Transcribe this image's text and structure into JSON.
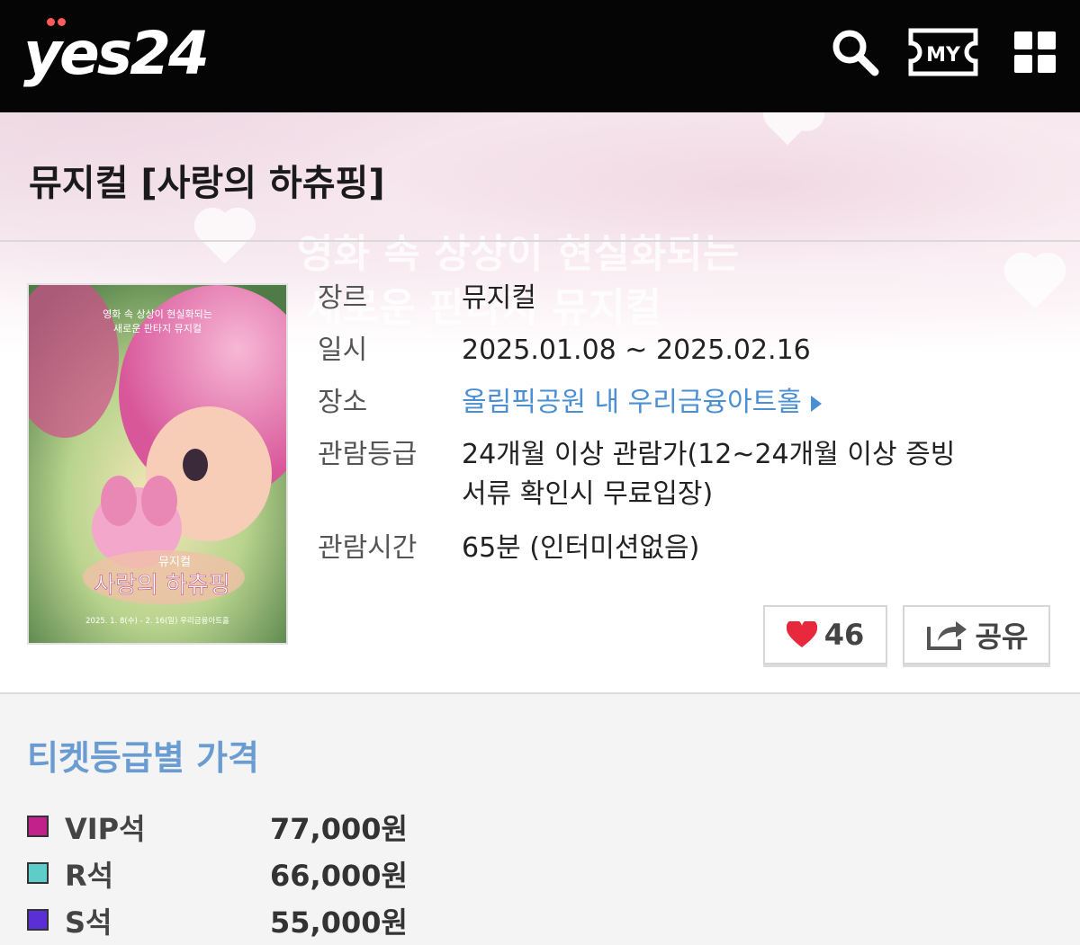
{
  "header": {
    "logo_text": "yes24",
    "icons": [
      "search-icon",
      "my-icon",
      "menu-grid-icon"
    ],
    "my_label": "MY",
    "colors": {
      "background": "#050505",
      "logo_dot": "#ff5b5b"
    }
  },
  "hero": {
    "backdrop_text_line1": "영화 속 상상이 현실화되는",
    "backdrop_text_line2": "새로운 판타지 뮤지컬"
  },
  "show": {
    "title": "뮤지컬 [사랑의 하츄핑]",
    "details": [
      {
        "label": "장르",
        "value": "뮤지컬"
      },
      {
        "label": "일시",
        "value": "2025.01.08 ~ 2025.02.16"
      },
      {
        "label": "장소",
        "value": "올림픽공원 내 우리금융아트홀"
      },
      {
        "label": "관람등급",
        "value_line1": "24개월 이상 관람가(12~24개월 이상 증빙",
        "value_line2": "서류 확인시 무료입장)"
      },
      {
        "label": "관람시간",
        "value": "65분 (인터미션없음)"
      }
    ],
    "poster": {
      "tagline_line1": "영화 속 상상이 현실화되는",
      "tagline_line2": "새로운 판타지 뮤지컬",
      "subtitle": "뮤지컬",
      "title": "사랑의 하츄핑",
      "dates_venue": "2025. 1. 8(수) - 2. 16(일) 우리금융아트홀"
    },
    "like_count": "46",
    "share_label": "공유",
    "link_color": "#4a8fd3"
  },
  "pricing": {
    "title": "티켓등급별 가격",
    "title_color": "#6a9cd1",
    "grades": [
      {
        "name": "VIP석",
        "price": "77,000원",
        "color": "#c2208a"
      },
      {
        "name": "R석",
        "price": "66,000원",
        "color": "#5ecdc9"
      },
      {
        "name": "S석",
        "price": "55,000원",
        "color": "#5a2fd6"
      }
    ]
  }
}
